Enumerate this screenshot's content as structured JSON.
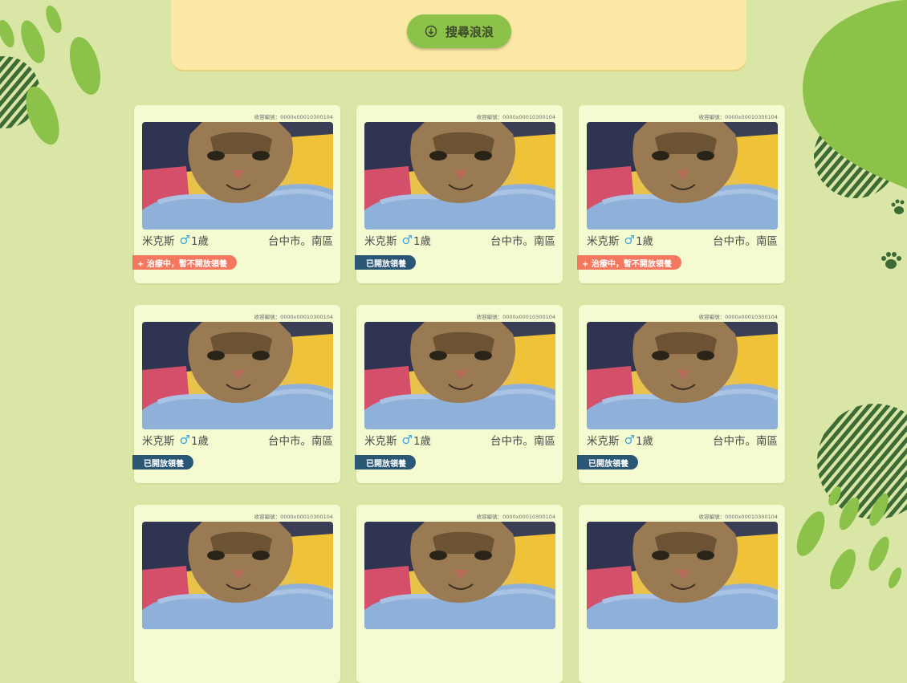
{
  "search": {
    "button_label": "搜尋浪浪",
    "icon": "arrow-down-circle-icon"
  },
  "colors": {
    "background": "#d9e6a6",
    "panel": "#fde9a6",
    "accent": "#8cc24a",
    "card": "#f5fbd1",
    "badge_treatment": "#f2795f",
    "badge_open": "#2b5777",
    "male": "#3aa7e0"
  },
  "cards": [
    {
      "id_text": "收容編號：0000x00010300104",
      "name": "米克斯",
      "gender_symbol": "♂",
      "age": "1歲",
      "location": "台中市。南區",
      "status": "+ 治療中，暫不開放領養",
      "status_type": "treatment"
    },
    {
      "id_text": "收容編號：0000x00010300104",
      "name": "米克斯",
      "gender_symbol": "♂",
      "age": "1歲",
      "location": "台中市。南區",
      "status": "已開放領養",
      "status_type": "open"
    },
    {
      "id_text": "收容編號：0000x00010300104",
      "name": "米克斯",
      "gender_symbol": "♂",
      "age": "1歲",
      "location": "台中市。南區",
      "status": "+ 治療中，暫不開放領養",
      "status_type": "treatment"
    },
    {
      "id_text": "收容編號：0000x00010300104",
      "name": "米克斯",
      "gender_symbol": "♂",
      "age": "1歲",
      "location": "台中市。南區",
      "status": "已開放領養",
      "status_type": "open"
    },
    {
      "id_text": "收容編號：0000x00010300104",
      "name": "米克斯",
      "gender_symbol": "♂",
      "age": "1歲",
      "location": "台中市。南區",
      "status": "已開放領養",
      "status_type": "open"
    },
    {
      "id_text": "收容編號：0000x00010300104",
      "name": "米克斯",
      "gender_symbol": "♂",
      "age": "1歲",
      "location": "台中市。南區",
      "status": "已開放領養",
      "status_type": "open"
    },
    {
      "id_text": "收容編號：0000x00010300104",
      "name": "",
      "gender_symbol": "",
      "age": "",
      "location": "",
      "status": "",
      "status_type": ""
    },
    {
      "id_text": "收容編號：0000x00010300104",
      "name": "",
      "gender_symbol": "",
      "age": "",
      "location": "",
      "status": "",
      "status_type": ""
    },
    {
      "id_text": "收容編號：0000x00010300104",
      "name": "",
      "gender_symbol": "",
      "age": "",
      "location": "",
      "status": "",
      "status_type": ""
    }
  ]
}
